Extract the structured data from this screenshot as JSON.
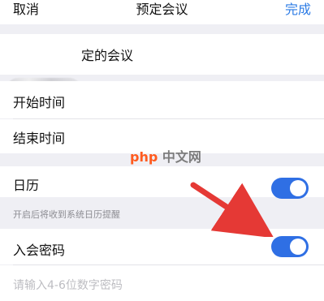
{
  "header": {
    "left_label": "取消",
    "title": "预定会议",
    "right_label": "完成"
  },
  "meeting": {
    "title_suffix": "定的会议"
  },
  "fields": {
    "start_time_label": "开始时间",
    "end_time_label": "结束时间",
    "calendar_label": "日历",
    "calendar_note": "开启后将收到系统日历提醒",
    "password_label": "入会密码",
    "password_placeholder": "请输入4-6位数字密码"
  },
  "watermark": {
    "php": "php",
    "cn": "中文网"
  },
  "colors": {
    "accent": "#2c7be5",
    "toggle_on": "#2f6fe4",
    "arrow": "#e53935"
  },
  "toggles": {
    "calendar_on": true,
    "password_on": true
  }
}
